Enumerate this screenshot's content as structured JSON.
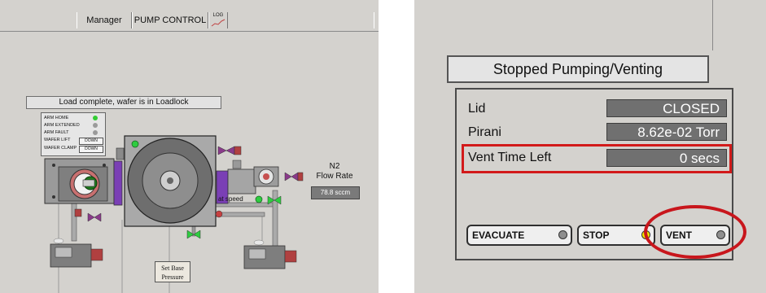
{
  "left_panel": {
    "tabs": [
      "Manager",
      "PUMP CONTROL",
      "LOG"
    ],
    "status_message": "Load complete, wafer is in Loadlock",
    "arm_status": [
      {
        "label": "ARM HOME",
        "led_color": "#33cc33"
      },
      {
        "label": "ARM EXTENDED",
        "led_color": "#9a9a9a"
      },
      {
        "label": "ARM FAULT",
        "led_color": "#9a9a9a"
      },
      {
        "label": "WAFER LIFT",
        "button": "DOWN"
      },
      {
        "label": "WAFER CLAMP",
        "button": "DOWN"
      }
    ],
    "flow_title_line1": "N2",
    "flow_title_line2": "Flow Rate",
    "flow_value": "78.8 sccm",
    "at_speed_label": "at speed",
    "set_base_line1": "Set Base",
    "set_base_line2": "Pressure"
  },
  "right_panel": {
    "state": "Stopped Pumping/Venting",
    "rows": [
      {
        "label": "Lid",
        "value": "CLOSED"
      },
      {
        "label": "Pirani",
        "value": "8.62e-02 Torr"
      },
      {
        "label": "Vent Time Left",
        "value": "0 secs"
      }
    ],
    "buttons": [
      {
        "label": "EVACUATE",
        "led_color": "#8f8f8f"
      },
      {
        "label": "STOP",
        "led_color": "#f2e600"
      },
      {
        "label": "VENT",
        "led_color": "#8f8f8f"
      }
    ]
  },
  "colors": {
    "panel_bg": "#d4d2ce",
    "highlight": "#d21a1a",
    "value_bg": "#707070"
  }
}
